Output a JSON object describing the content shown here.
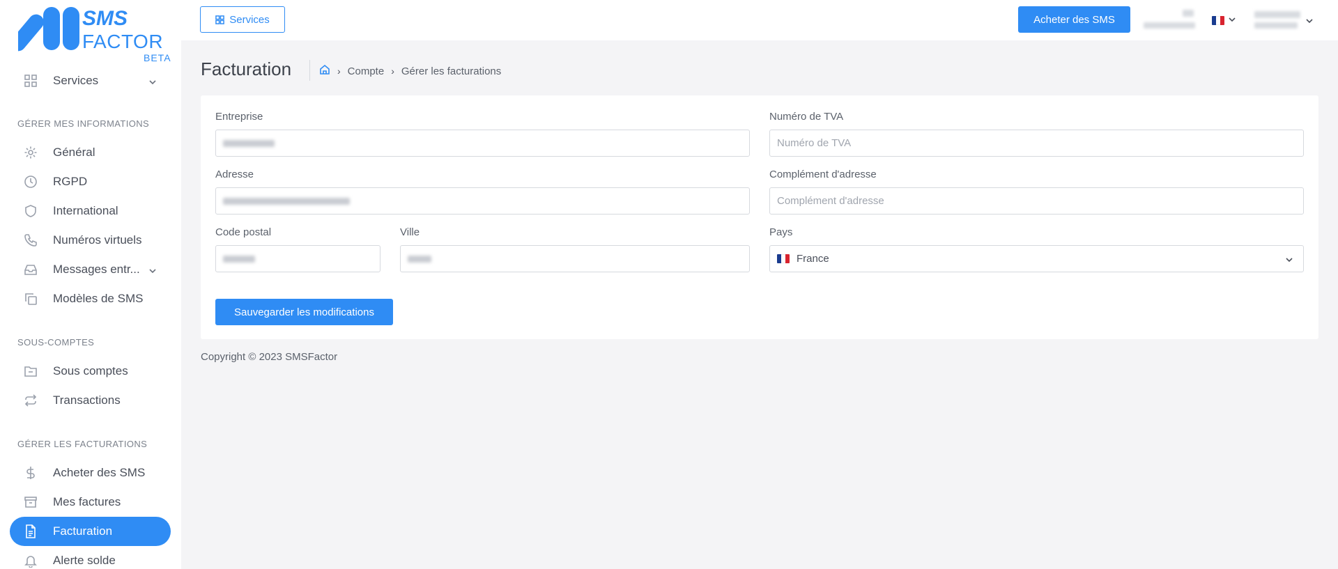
{
  "brand": {
    "line1": "SMS",
    "line2": "FACTOR",
    "line3": "BETA",
    "accent_color": "#2f8cf4"
  },
  "sidebar": {
    "services": {
      "label": "Services",
      "icon": "grid-icon"
    },
    "sections": [
      {
        "title": "GÉRER MES INFORMATIONS",
        "items": [
          {
            "label": "Général",
            "icon": "gear-icon"
          },
          {
            "label": "RGPD",
            "icon": "clock-icon"
          },
          {
            "label": "International",
            "icon": "shield-icon"
          },
          {
            "label": "Numéros virtuels",
            "icon": "phone-icon"
          },
          {
            "label": "Messages entr...",
            "icon": "inbox-icon"
          },
          {
            "label": "Modèles de SMS",
            "icon": "copy-icon"
          }
        ]
      },
      {
        "title": "SOUS-COMPTES",
        "items": [
          {
            "label": "Sous comptes",
            "icon": "folder-icon"
          },
          {
            "label": "Transactions",
            "icon": "repeat-icon"
          }
        ]
      },
      {
        "title": "GÉRER LES FACTURATIONS",
        "items": [
          {
            "label": "Acheter des SMS",
            "icon": "dollar-icon"
          },
          {
            "label": "Mes factures",
            "icon": "archive-icon"
          },
          {
            "label": "Facturation",
            "icon": "file-text-icon",
            "active": true
          },
          {
            "label": "Alerte solde",
            "icon": "bell-icon"
          }
        ]
      }
    ]
  },
  "header": {
    "services_label": "Services",
    "buy_label": "Acheter des SMS",
    "language": "fr"
  },
  "page": {
    "title": "Facturation",
    "breadcrumb": [
      "Compte",
      "Gérer les facturations"
    ]
  },
  "form": {
    "company_label": "Entreprise",
    "vat_label": "Numéro de TVA",
    "vat_placeholder": "Numéro de TVA",
    "address_label": "Adresse",
    "address2_label": "Complément d'adresse",
    "address2_placeholder": "Complément d'adresse",
    "postal_label": "Code postal",
    "city_label": "Ville",
    "country_label": "Pays",
    "country_value": "France",
    "save_label": "Sauvegarder les modifications"
  },
  "footer": {
    "copyright": "Copyright © 2023 SMSFactor"
  }
}
